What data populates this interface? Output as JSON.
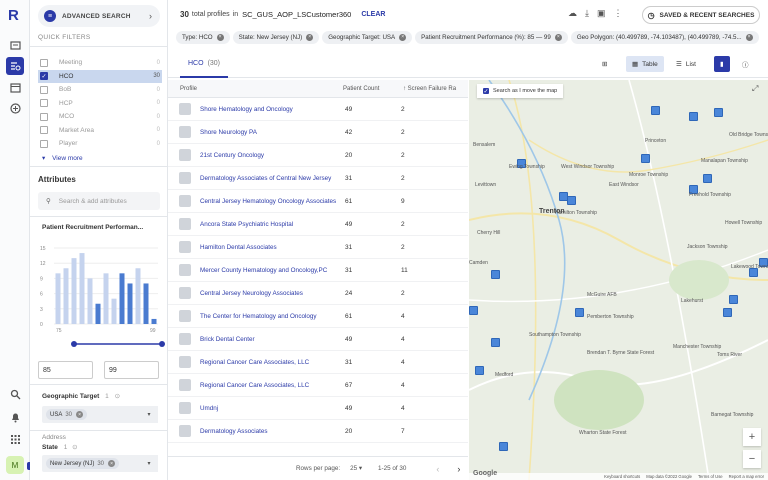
{
  "app": {
    "logo": "R"
  },
  "left_panel": {
    "advanced_search_label": "ADVANCED SEARCH",
    "quick_filters_label": "QUICK FILTERS",
    "types": [
      {
        "label": "Meeting",
        "count": "0",
        "checked": false
      },
      {
        "label": "HCO",
        "count": "30",
        "checked": true
      },
      {
        "label": "BoB",
        "count": "0",
        "checked": false
      },
      {
        "label": "HCP",
        "count": "0",
        "checked": false
      },
      {
        "label": "MCO",
        "count": "0",
        "checked": false
      },
      {
        "label": "Market Area",
        "count": "0",
        "checked": false
      },
      {
        "label": "Player",
        "count": "0",
        "checked": false
      }
    ],
    "view_more": "View more",
    "attributes_title": "Attributes",
    "attr_search_placeholder": "Search & add attributes",
    "prp_title": "Patient Recruitment Performan...",
    "hist_y_ticks": [
      "15",
      "12",
      "9",
      "6",
      "3",
      "0"
    ],
    "hist_x_ticks": [
      "75",
      "99"
    ],
    "hist_values": [
      {
        "v": 10,
        "sel": false
      },
      {
        "v": 11,
        "sel": false
      },
      {
        "v": 13,
        "sel": false
      },
      {
        "v": 14,
        "sel": false
      },
      {
        "v": 9,
        "sel": false
      },
      {
        "v": 4,
        "sel": true
      },
      {
        "v": 10,
        "sel": false
      },
      {
        "v": 5,
        "sel": false
      },
      {
        "v": 10,
        "sel": true
      },
      {
        "v": 8,
        "sel": true
      },
      {
        "v": 11,
        "sel": false
      },
      {
        "v": 8,
        "sel": true
      },
      {
        "v": 1,
        "sel": true
      }
    ],
    "slider_range": [
      85,
      99
    ],
    "range_min": "85",
    "range_max": "99",
    "geo_target_label": "Geographic Target",
    "geo_target_count": "1",
    "geo_chip": "USA",
    "geo_chip_count": "30",
    "address_label": "Address",
    "state_label": "State",
    "state_count": "1",
    "state_chip": "New Jersey (NJ)",
    "state_chip_count": "30",
    "avatar": "M"
  },
  "topbar": {
    "total": "30",
    "total_text": "total profiles",
    "in_text": "in",
    "segment": "SC_GUS_AOP_LSCustomer360",
    "clear": "CLEAR",
    "saved_searches": "SAVED & RECENT SEARCHES"
  },
  "filters": [
    "Type: HCO",
    "State: New Jersey (NJ)",
    "Geographic Target: USA",
    "Patient Recruitment Performance (%): 85 — 99",
    "Geo Polygon: (40.499789, -74.103487), (40.499789, -74.5..."
  ],
  "tabs": {
    "hco": "HCO",
    "hco_count": "(30)",
    "table": "Table",
    "list": "List"
  },
  "table": {
    "col_profile": "Profile",
    "col_patient": "Patient Count",
    "col_screen": "Screen Failure Ra",
    "rows": [
      {
        "name": "Shore Hematology and Oncology",
        "patients": "49",
        "screen": "2"
      },
      {
        "name": "Shore Neurology PA",
        "patients": "42",
        "screen": "2"
      },
      {
        "name": "21st Century Oncology",
        "patients": "20",
        "screen": "2"
      },
      {
        "name": "Dermatology Associates of Central New Jersey",
        "patients": "31",
        "screen": "2"
      },
      {
        "name": "Central Jersey Hematology Oncology Associates",
        "patients": "61",
        "screen": "9"
      },
      {
        "name": "Ancora State Psychiatric Hospital",
        "patients": "49",
        "screen": "2"
      },
      {
        "name": "Hamilton Dental Associates",
        "patients": "31",
        "screen": "2"
      },
      {
        "name": "Mercer County Hematology and Oncology,PC",
        "patients": "31",
        "screen": "11"
      },
      {
        "name": "Central Jersey Neurology Associates",
        "patients": "24",
        "screen": "2"
      },
      {
        "name": "The Center for Hematology and Oncology",
        "patients": "61",
        "screen": "4"
      },
      {
        "name": "Brick Dental Center",
        "patients": "49",
        "screen": "4"
      },
      {
        "name": "Regional Cancer Care Associates, LLC",
        "patients": "31",
        "screen": "4"
      },
      {
        "name": "Regional Cancer Care Associates, LLC",
        "patients": "67",
        "screen": "4"
      },
      {
        "name": "Umdnj",
        "patients": "49",
        "screen": "4"
      },
      {
        "name": "Dermatology Associates",
        "patients": "20",
        "screen": "7"
      }
    ]
  },
  "pager": {
    "rows_label": "Rows per page:",
    "rows_value": "25",
    "range": "1-25 of 30"
  },
  "map": {
    "search_as_move": "Search as I move the map",
    "labels": [
      {
        "t": "Bensalem"
      },
      {
        "t": "Levittown"
      },
      {
        "t": "Trenton"
      },
      {
        "t": "Ewing Township"
      },
      {
        "t": "Hamilton Township"
      },
      {
        "t": "West Windsor Township"
      },
      {
        "t": "East Windsor"
      },
      {
        "t": "Princeton"
      },
      {
        "t": "Freehold Township"
      },
      {
        "t": "Manalapan Township"
      },
      {
        "t": "Howell Township"
      },
      {
        "t": "Lakewood Township"
      },
      {
        "t": "Jackson Township"
      },
      {
        "t": "Lakehurst"
      },
      {
        "t": "McGuire AFB"
      },
      {
        "t": "Pemberton Township"
      },
      {
        "t": "Southampton Township"
      },
      {
        "t": "Brendan T. Byrne State Forest"
      },
      {
        "t": "Medford"
      },
      {
        "t": "Manchester Township"
      },
      {
        "t": "Toms River"
      },
      {
        "t": "Barnegat Township"
      },
      {
        "t": "Wharton State Forest"
      },
      {
        "t": "Monroe Township"
      },
      {
        "t": "Old Bridge Township"
      },
      {
        "t": "Cherry Hill"
      },
      {
        "t": "Camden"
      }
    ],
    "footer": [
      "Keyboard shortcuts",
      "Map data ©2022 Google",
      "Terms of Use",
      "Report a map error"
    ],
    "google": "Google"
  },
  "colors": {
    "brand": "#2b3aa8",
    "pin": "#4a86d9",
    "hist_bar": "#c5d3ee",
    "hist_bar_sel": "#4a7bd0"
  }
}
